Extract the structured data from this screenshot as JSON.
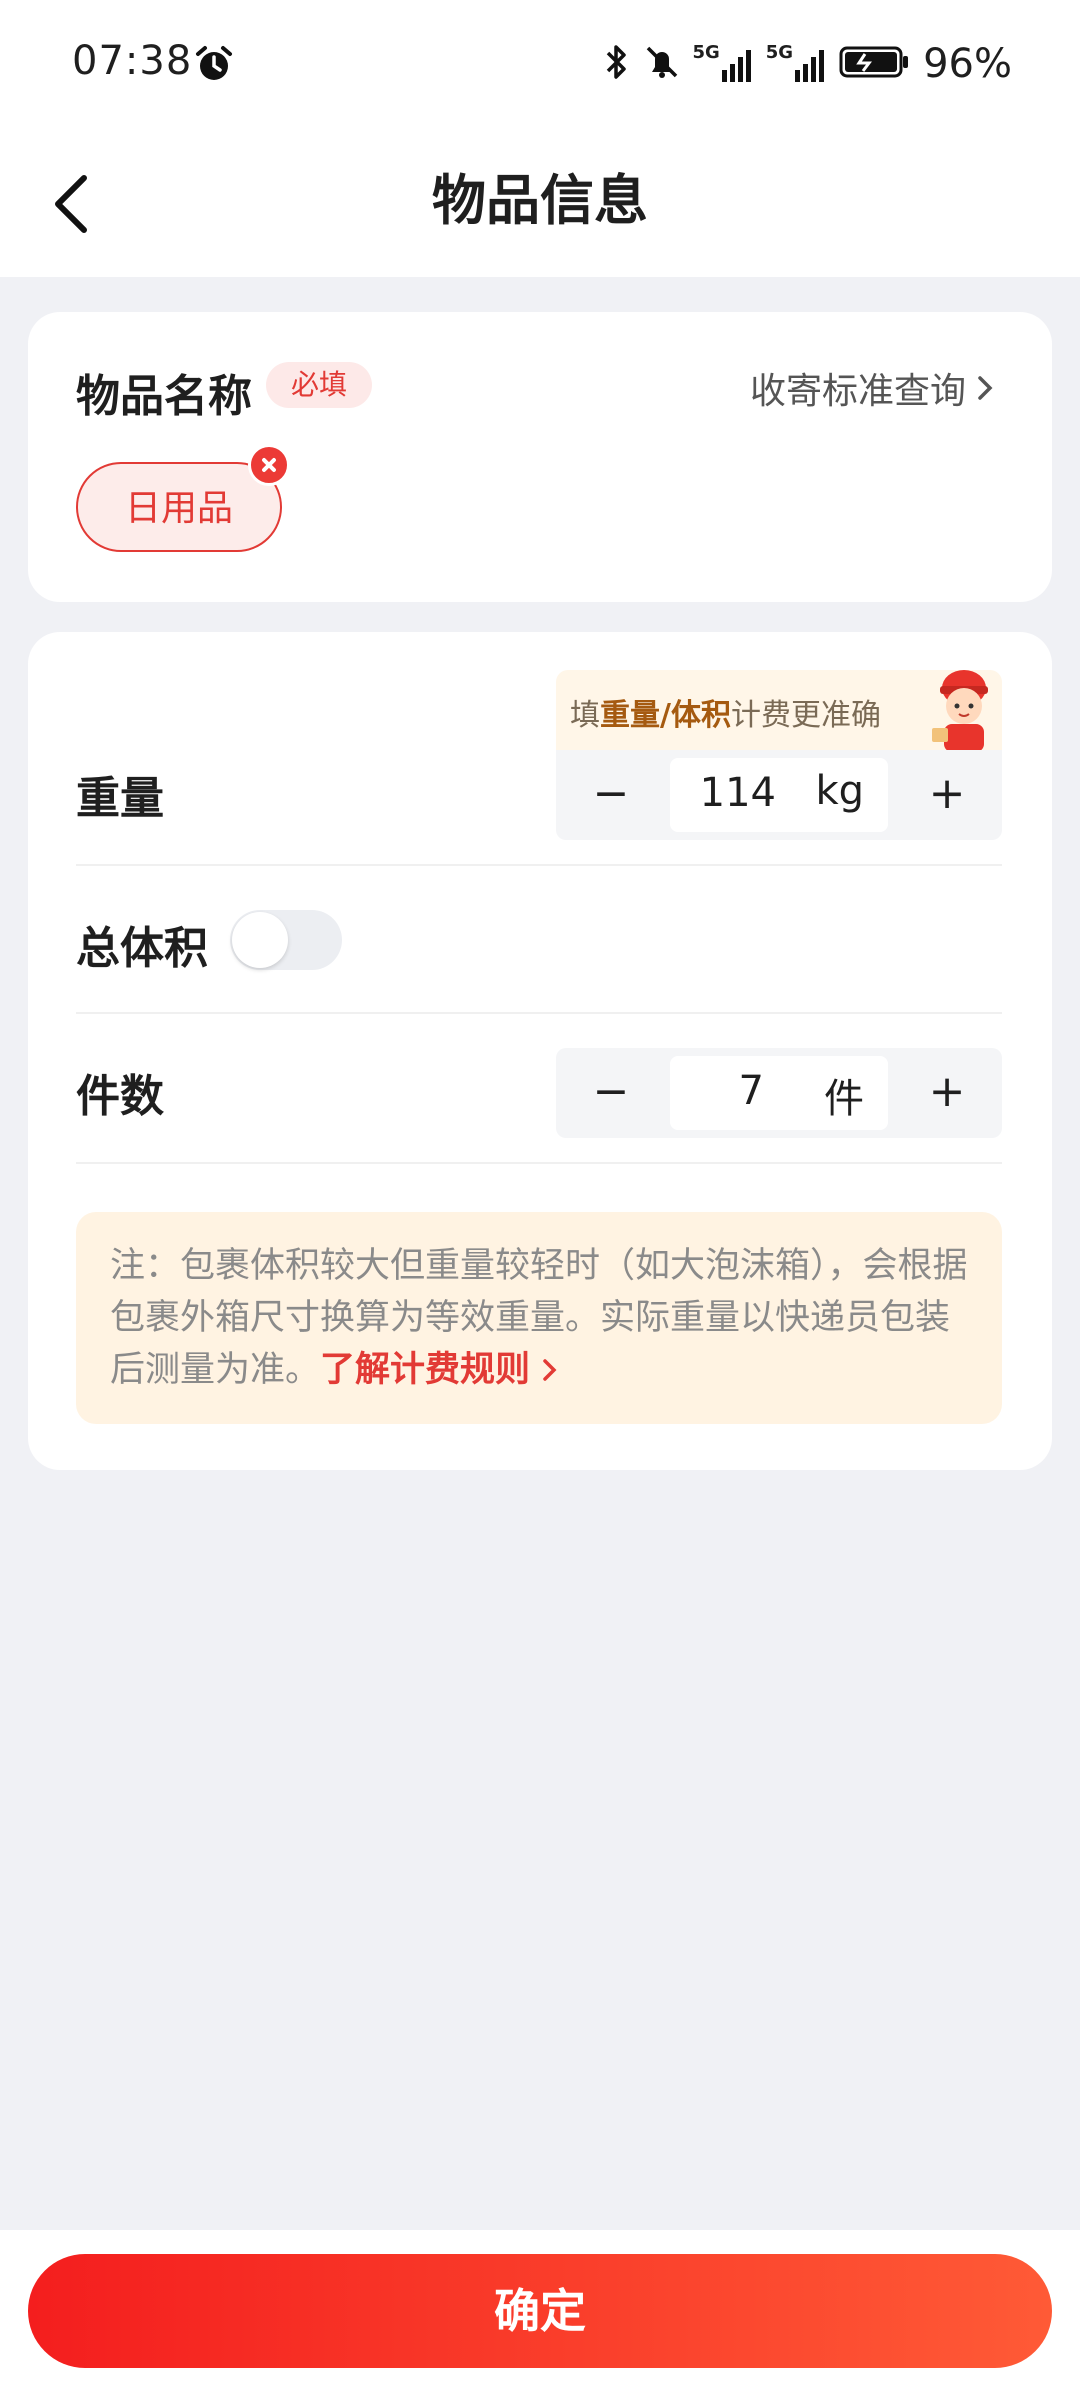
{
  "status_bar": {
    "time": "07:38",
    "net1": "5G",
    "net2": "5G",
    "battery": "96%"
  },
  "nav": {
    "title": "物品信息"
  },
  "item_name": {
    "title": "物品名称",
    "required_badge": "必填",
    "standard_link": "收寄标准查询",
    "selected_tag": "日用品"
  },
  "params": {
    "hint_prefix": "填",
    "hint_highlight": "重量/体积",
    "hint_suffix": "计费更准确",
    "weight": {
      "label": "重量",
      "value": "114",
      "unit": "kg"
    },
    "volume": {
      "label": "总体积",
      "enabled": false
    },
    "count": {
      "label": "件数",
      "value": "7",
      "unit": "件"
    },
    "minus_symbol": "−",
    "plus_symbol": "+"
  },
  "note": {
    "text": "注：包裹体积较大但重量较轻时（如大泡沫箱），会根据包裹外箱尺寸换算为等效重量。实际重量以快递员包装后测量为准。",
    "link": "了解计费规则"
  },
  "footer": {
    "confirm_label": "确定"
  },
  "colors": {
    "accent": "#e23a35",
    "button_start": "#f41e1e",
    "button_end": "#ff5a36",
    "page_bg": "#f0f1f5"
  }
}
